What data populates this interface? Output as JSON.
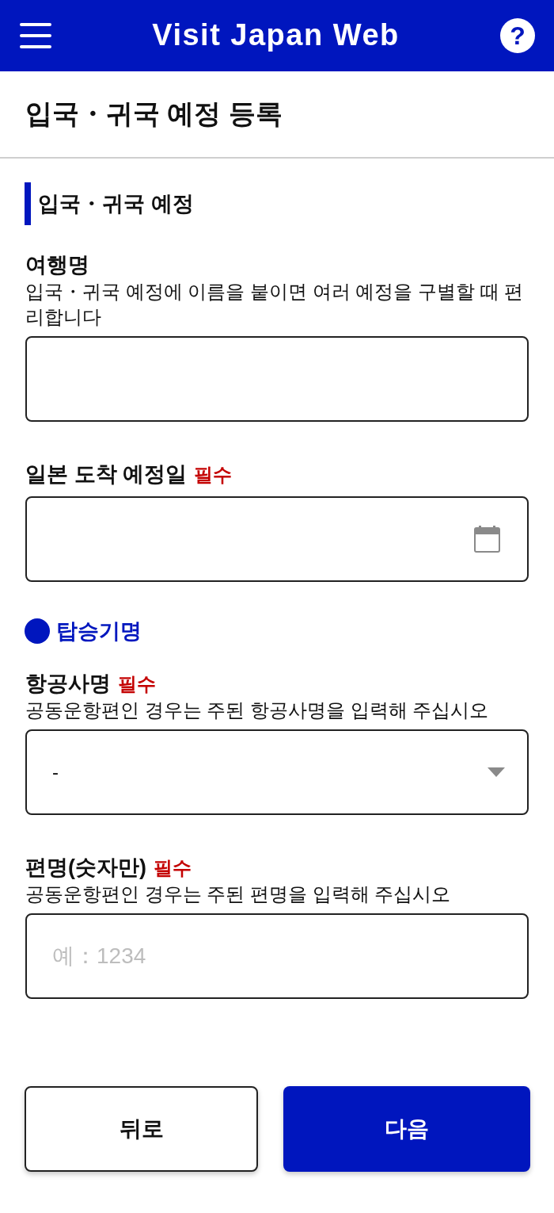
{
  "header": {
    "title": "Visit Japan Web",
    "help_label": "?"
  },
  "page_title": "입국・귀국 예정 등록",
  "sections": [
    {
      "kind": "bar",
      "title": "입국・귀국 예정",
      "fields": [
        {
          "kind": "text",
          "label": "여행명",
          "hint": "입국・귀국 예정에 이름을 붙이면 여러 예정을 구별할 때 편리합니다"
        },
        {
          "kind": "date",
          "label": "일본 도착 예정일",
          "required_badge": "필수"
        }
      ]
    },
    {
      "kind": "dot",
      "title": "탑승기명",
      "fields": [
        {
          "kind": "select",
          "label": "항공사명",
          "required_badge": "필수",
          "hint": "공동운항편인 경우는 주된 항공사명을 입력해 주십시오",
          "value": "-"
        },
        {
          "kind": "text",
          "label": "편명(숫자만)",
          "required_badge": "필수",
          "hint": "공동운항편인 경우는 주된 편명을 입력해 주십시오",
          "placeholder": "예：1234"
        }
      ]
    }
  ],
  "buttons": [
    {
      "kind": "secondary",
      "label": "뒤로"
    },
    {
      "kind": "primary",
      "label": "다음"
    }
  ]
}
